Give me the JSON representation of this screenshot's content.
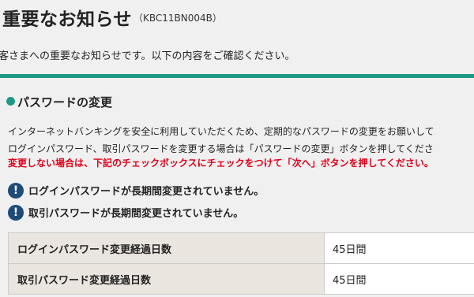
{
  "header": {
    "title": "重要なお知らせ",
    "code": "（KBC11BN004B）"
  },
  "intro": "客さまへの重要なお知らせです。以下の内容をご確認ください。",
  "section": {
    "title": "パスワードの変更",
    "lines": [
      "インターネットバンキングを安全に利用していただくため、定期的なパスワードの変更をお願いして",
      "ログインパスワード、取引パスワードを変更する場合は「パスワードの変更」ボタンを押してくださ"
    ],
    "warning": "変更しない場合は、下記のチェックボックスにチェックをつけて「次へ」ボタンを押してください。"
  },
  "alerts": [
    {
      "icon": "exclamation-icon",
      "text": "ログインパスワードが長期間変更されていません。"
    },
    {
      "icon": "exclamation-icon",
      "text": "取引パスワードが長期間変更されていません。"
    }
  ],
  "table": {
    "rows": [
      {
        "label": "ログインパスワード変更経過日数",
        "value": "45日間"
      },
      {
        "label": "取引パスワード変更経過日数",
        "value": "45日間"
      }
    ]
  },
  "colors": {
    "accent": "#1d9a83",
    "warning": "#e0001a",
    "alert_icon": "#1e4b77",
    "table_label_bg": "#ebe5df"
  }
}
